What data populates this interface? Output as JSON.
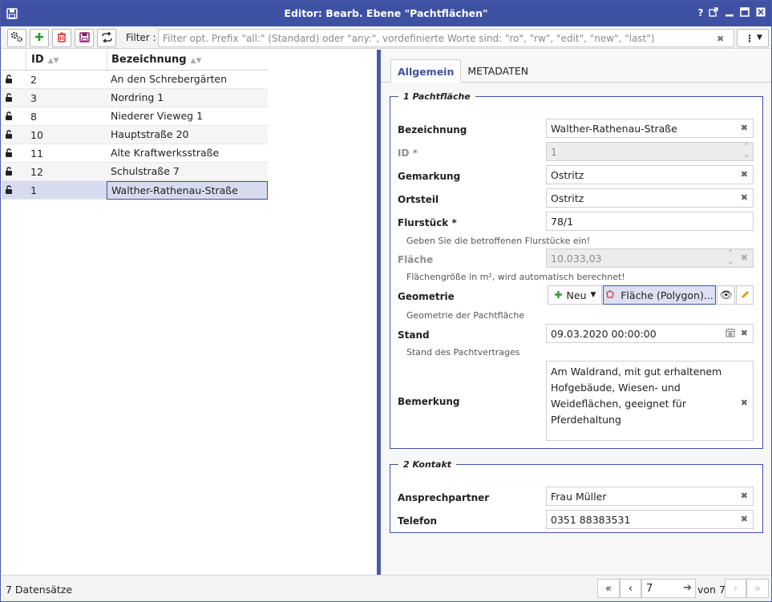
{
  "window": {
    "title": "Editor: Bearb. Ebene \"Pachtflächen\""
  },
  "toolbar": {
    "filter_label": "Filter :",
    "filter_placeholder": "Filter opt. Prefix \"all:\" (Standard) oder \"any:\", vordefinierte Worte sind: \"ro\", \"rw\", \"edit\", \"new\", \"last\")",
    "filter_value": ""
  },
  "grid": {
    "columns": [
      {
        "label": "ID"
      },
      {
        "label": "Bezeichnung"
      }
    ],
    "rows": [
      {
        "id": "2",
        "name": "An den Schrebergärten"
      },
      {
        "id": "3",
        "name": "Nordring 1"
      },
      {
        "id": "8",
        "name": "Niederer Vieweg 1"
      },
      {
        "id": "10",
        "name": "Hauptstraße 20"
      },
      {
        "id": "11",
        "name": "Alte Kraftwerksstraße"
      },
      {
        "id": "12",
        "name": "Schulstraße 7"
      },
      {
        "id": "1",
        "name": "Walther-Rathenau-Straße"
      }
    ],
    "selected_index": 6
  },
  "tabs": [
    {
      "label": "Allgemein",
      "active": true
    },
    {
      "label": "METADATEN",
      "active": false
    }
  ],
  "section1": {
    "legend": "1 Pachtfläche",
    "bezeichnung": {
      "label": "Bezeichnung",
      "value": "Walther-Rathenau-Straße"
    },
    "id": {
      "label": "ID *",
      "value": "1"
    },
    "gemarkung": {
      "label": "Gemarkung",
      "value": "Ostritz"
    },
    "ortsteil": {
      "label": "Ortsteil",
      "value": "Ostritz"
    },
    "flurstueck": {
      "label": "Flurstück *",
      "value": "78/1",
      "hint": "Geben Sie die betroffenen Flurstücke ein!"
    },
    "flaeche": {
      "label": "Fläche",
      "value": "10.033,03",
      "hint": "Flächengröße in m², wird automatisch berechnet!"
    },
    "geometrie": {
      "label": "Geometrie",
      "new_label": "Neu",
      "polygon_label": "Fläche (Polygon)...",
      "hint": "Geometrie der Pachtfläche"
    },
    "stand": {
      "label": "Stand",
      "value": "09.03.2020 00:00:00",
      "hint": "Stand des Pachtvertrages"
    },
    "bemerkung": {
      "label": "Bemerkung",
      "value": "Am Waldrand, mit gut erhaltenem Hofgebäude, Wiesen- und Weideflächen, geeignet für Pferdehaltung"
    }
  },
  "section2": {
    "legend": "2 Kontakt",
    "ansprechpartner": {
      "label": "Ansprechpartner",
      "value": "Frau Müller"
    },
    "telefon": {
      "label": "Telefon",
      "value": "0351 88383531"
    }
  },
  "statusbar": {
    "count": "7 Datensätze",
    "page_value": "7",
    "page_total": "von 7"
  },
  "icons": [
    "save-icon",
    "help-icon",
    "external-icon",
    "minimize-icon",
    "maximize-icon",
    "close-icon",
    "settings-icon",
    "add-icon",
    "delete-icon",
    "save-icon",
    "refresh-icon",
    "clear-icon",
    "menu-icon",
    "lock-icon",
    "polygon-icon",
    "eye-icon",
    "pencil-icon",
    "calendar-icon",
    "first-page-icon",
    "prev-page-icon",
    "next-page-icon",
    "last-page-icon"
  ],
  "colors": {
    "accent": "#3f51a3",
    "add": "#2e9a2e",
    "delete": "#d9312b",
    "polygon": "#d93636",
    "edit": "#e8951a"
  }
}
